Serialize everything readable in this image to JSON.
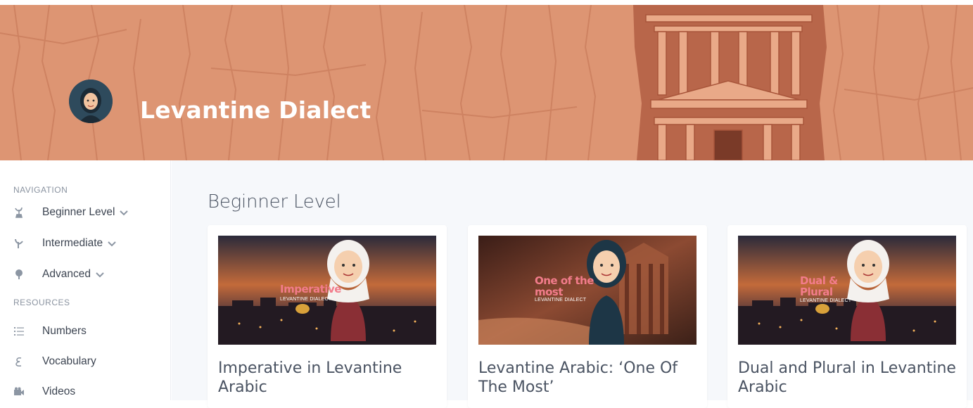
{
  "banner": {
    "title": "Levantine Dialect",
    "background_color": "#dd9573"
  },
  "sidebar": {
    "navigation_label": "NAVIGATION",
    "resources_label": "RESOURCES",
    "nav_items": [
      {
        "label": "Beginner Level",
        "icon": "sprout-icon"
      },
      {
        "label": "Intermediate",
        "icon": "plant-icon"
      },
      {
        "label": "Advanced",
        "icon": "tree-icon"
      }
    ],
    "resource_items": [
      {
        "label": "Numbers",
        "icon": "list-ordered-icon"
      },
      {
        "label": "Vocabulary",
        "icon": "arabic-letter-icon"
      },
      {
        "label": "Videos",
        "icon": "video-camera-icon"
      }
    ]
  },
  "main": {
    "section_title": "Beginner Level",
    "cards": [
      {
        "title": "Imperative in Levantine Arabic",
        "thumb_text": "Imperative",
        "thumb_sub": "LEVANTINE DIALECT"
      },
      {
        "title": "Levantine Arabic: ‘One Of The Most’",
        "thumb_text": "One of the most",
        "thumb_sub": "LEVANTINE DIALECT"
      },
      {
        "title": "Dual and Plural in Levantine Arabic",
        "thumb_text": "Dual & Plural",
        "thumb_sub": "LEVANTINE DIALECT"
      }
    ]
  },
  "colors": {
    "accent_pink": "#f27c8b",
    "text_dark": "#3d4552",
    "muted": "#8a93a0"
  }
}
